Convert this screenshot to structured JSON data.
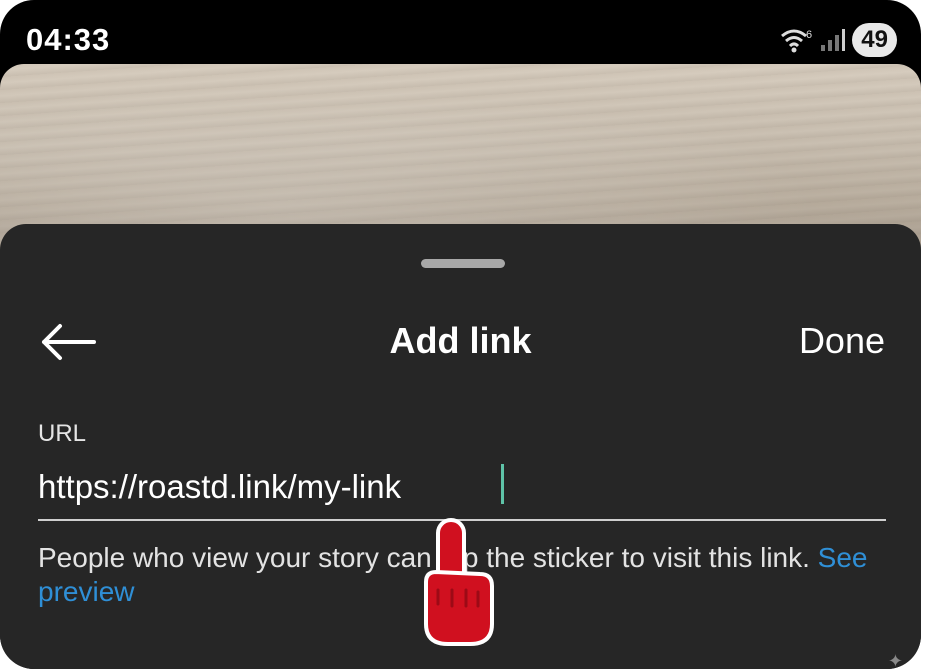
{
  "status_bar": {
    "time": "04:33",
    "battery": "49",
    "network": "6",
    "icons": [
      "wifi-icon",
      "signal-icon",
      "battery-icon"
    ]
  },
  "sheet": {
    "title": "Add link",
    "done_label": "Done",
    "back_icon": "arrow-left-icon",
    "url_label": "URL",
    "url_value": "https://roastd.link/my-link",
    "helper_text": "People who view your story can tap the sticker to visit this link.",
    "preview_link": "See preview"
  },
  "colors": {
    "sheet_bg": "#262626",
    "link": "#2f8fd6",
    "caret": "#5fc3a8",
    "pointer_hand": "#d0101f"
  }
}
